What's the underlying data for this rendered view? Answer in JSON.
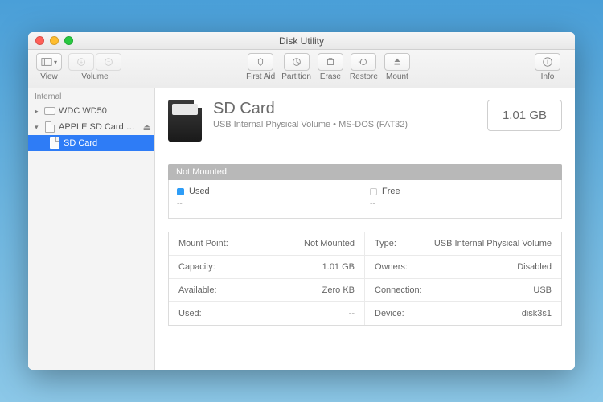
{
  "window": {
    "title": "Disk Utility"
  },
  "toolbar": {
    "view": "View",
    "volume": "Volume",
    "first_aid": "First Aid",
    "partition": "Partition",
    "erase": "Erase",
    "restore": "Restore",
    "mount": "Mount",
    "info": "Info"
  },
  "sidebar": {
    "section": "Internal",
    "items": [
      {
        "label": "WDC WD50",
        "expandable": true,
        "expanded": false
      },
      {
        "label": "APPLE SD Card R...",
        "expandable": true,
        "expanded": true,
        "ejectable": true,
        "children": [
          {
            "label": "SD Card",
            "selected": true
          }
        ]
      }
    ]
  },
  "volume": {
    "name": "SD Card",
    "subtitle": "USB Internal Physical Volume • MS-DOS (FAT32)",
    "size": "1.01 GB",
    "status": "Not Mounted",
    "usage": {
      "used_label": "Used",
      "used_value": "--",
      "free_label": "Free",
      "free_value": "--"
    },
    "details_left": [
      {
        "k": "Mount Point:",
        "v": "Not Mounted"
      },
      {
        "k": "Capacity:",
        "v": "1.01 GB"
      },
      {
        "k": "Available:",
        "v": "Zero KB"
      },
      {
        "k": "Used:",
        "v": "--"
      }
    ],
    "details_right": [
      {
        "k": "Type:",
        "v": "USB Internal Physical Volume"
      },
      {
        "k": "Owners:",
        "v": "Disabled"
      },
      {
        "k": "Connection:",
        "v": "USB"
      },
      {
        "k": "Device:",
        "v": "disk3s1"
      }
    ]
  }
}
